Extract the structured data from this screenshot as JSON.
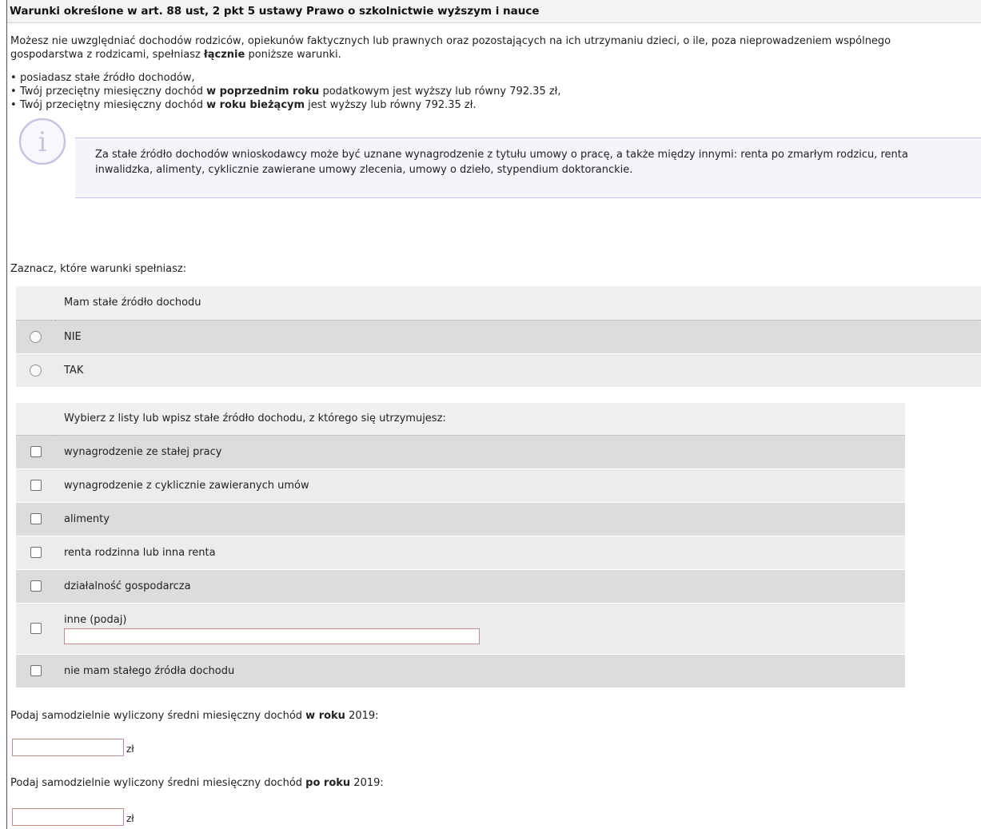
{
  "header": {
    "title": "Warunki określone w art. 88 ust, 2 pkt 5 ustawy Prawo o szkolnictwie wyższym i nauce"
  },
  "intro": {
    "text_a": "Możesz nie uwzględniać dochodów rodziców, opiekunów faktycznych lub prawnych oraz pozostających na ich utrzymaniu dzieci, o ile, poza nieprowadzeniem wspólnego gospodarstwa z rodzicami, spełniasz ",
    "text_bold": "łącznie",
    "text_b": " poniższe warunki."
  },
  "conditions": [
    {
      "a": "posiadasz stałe źródło dochodów,",
      "bold": "",
      "b": ""
    },
    {
      "a": "Twój przeciętny miesięczny dochód ",
      "bold": "w poprzednim roku",
      "b": " podatkowym jest wyższy lub równy 792.35 zł,"
    },
    {
      "a": "Twój przeciętny miesięczny dochód ",
      "bold": "w roku bieżącym",
      "b": " jest wyższy lub równy 792.35 zł."
    }
  ],
  "info": {
    "icon_char": "i",
    "text": "Za stałe źródło dochodów wnioskodawcy może być uznane wynagrodzenie z tytułu umowy o pracę, a także między innymi: renta po zmarłym rodzicu, renta inwalidzka, alimenty, cyklicznie zawierane umowy zlecenia, umowy o dzieło, stypendium doktoranckie."
  },
  "question1": {
    "prompt": "Zaznacz, które warunki spełniasz:",
    "header": "Mam stałe źródło dochodu",
    "options": [
      "NIE",
      "TAK"
    ]
  },
  "question2": {
    "header": "Wybierz z listy lub wpisz stałe źródło dochodu, z którego się utrzymujesz:",
    "options": [
      "wynagrodzenie ze stałej pracy",
      "wynagrodzenie z cyklicznie zawieranych umów",
      "alimenty",
      "renta rodzinna lub inna renta",
      "działalność gospodarcza",
      "inne (podaj)",
      "nie mam stałego źródła dochodu"
    ],
    "other_value": ""
  },
  "income": {
    "q1_a": "Podaj samodzielnie wyliczony średni miesięczny dochód ",
    "q1_bold": "w roku",
    "q1_b": " 2019:",
    "q1_value": "",
    "q2_a": "Podaj samodzielnie wyliczony średni miesięczny dochód ",
    "q2_bold": "po roku",
    "q2_b": " 2019:",
    "q2_value": "",
    "unit": "zł"
  },
  "colors": {
    "info_border": "#c7c3e3",
    "input_border": "#c98a8a",
    "row_dark": "#dcdcdc",
    "row_light": "#ececec"
  }
}
